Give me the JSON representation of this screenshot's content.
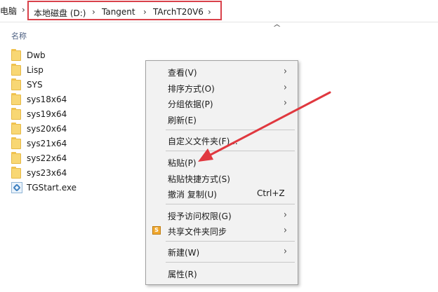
{
  "address_bar": {
    "prefix": "电脑",
    "crumbs": [
      "本地磁盘 (D:)",
      "Tangent",
      "TArchT20V6"
    ],
    "dropdown": "⌄",
    "highlight_color": "#d9414a"
  },
  "columns": {
    "name": "名称"
  },
  "files": [
    {
      "name": "Dwb",
      "type": "folder"
    },
    {
      "name": "Lisp",
      "type": "folder"
    },
    {
      "name": "SYS",
      "type": "folder"
    },
    {
      "name": "sys18x64",
      "type": "folder"
    },
    {
      "name": "sys19x64",
      "type": "folder"
    },
    {
      "name": "sys20x64",
      "type": "folder"
    },
    {
      "name": "sys21x64",
      "type": "folder"
    },
    {
      "name": "sys22x64",
      "type": "folder"
    },
    {
      "name": "sys23x64",
      "type": "folder"
    },
    {
      "name": "TGStart.exe",
      "type": "exe"
    }
  ],
  "context_menu": {
    "view": "查看(V)",
    "sort": "排序方式(O)",
    "group": "分组依据(P)",
    "refresh": "刷新(E)",
    "customize": "自定义文件夹(F)...",
    "paste": "粘贴(P)",
    "paste_shortcut": "粘贴快捷方式(S)",
    "undo": "撤消 复制(U)",
    "undo_shortcut": "Ctrl+Z",
    "grant_access": "授予访问权限(G)",
    "sync": "共享文件夹同步",
    "new": "新建(W)",
    "properties": "属性(R)"
  },
  "annotation_arrow_color": "#e0383f"
}
